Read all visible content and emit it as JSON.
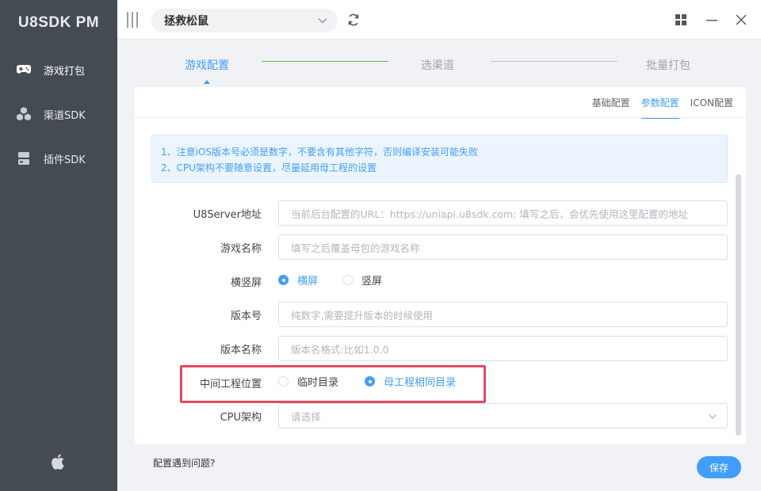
{
  "app": {
    "brand": "U8SDK PM"
  },
  "sidebar": {
    "items": [
      {
        "label": "游戏打包",
        "icon": "gamepad-icon",
        "active": true
      },
      {
        "label": "渠道SDK",
        "icon": "cubes-icon",
        "active": false
      },
      {
        "label": "插件SDK",
        "icon": "plugin-icon",
        "active": false
      }
    ],
    "footer_icon": "apple-icon"
  },
  "topbar": {
    "project": "拯救松鼠",
    "icons": [
      "menu-grip-icon",
      "chevron-down-icon",
      "refresh-icon",
      "grid-icon",
      "minimize-icon",
      "close-icon"
    ]
  },
  "steps": [
    {
      "label": "游戏配置",
      "active": true
    },
    {
      "label": "选渠道",
      "active": false
    },
    {
      "label": "批量打包",
      "active": false
    }
  ],
  "subtabs": [
    {
      "label": "基础配置",
      "active": false
    },
    {
      "label": "参数配置",
      "active": true
    },
    {
      "label": "ICON配置",
      "active": false
    }
  ],
  "notice": {
    "line1": "1、注意iOS版本号必须是数字，不要含有其他字符，否则编译安装可能失败",
    "line2": "2、CPU架构不要随意设置，尽量延用母工程的设置"
  },
  "form": {
    "server_url": {
      "label": "U8Server地址",
      "placeholder": "当前后台配置的URL：https://uniapi.u8sdk.com; 填写之后，会优先使用这里配置的地址",
      "value": ""
    },
    "game_name": {
      "label": "游戏名称",
      "placeholder": "填写之后覆盖母包的游戏名称",
      "value": ""
    },
    "orientation": {
      "label": "横竖屏",
      "options": [
        "横屏",
        "竖屏"
      ],
      "selected": "横屏"
    },
    "version_code": {
      "label": "版本号",
      "placeholder": "纯数字,需要提升版本的时候使用",
      "value": ""
    },
    "version_name": {
      "label": "版本名称",
      "placeholder": "版本名格式:比如1.0.0",
      "value": ""
    },
    "mid_project": {
      "label": "中间工程位置",
      "options": [
        "临时目录",
        "母工程相同目录"
      ],
      "selected": "母工程相同目录"
    },
    "cpu_arch": {
      "label": "CPU架构",
      "placeholder": "请选择",
      "value": ""
    }
  },
  "footer": {
    "help_link": "配置遇到问题?",
    "save_label": "保存"
  },
  "colors": {
    "primary": "#409eff",
    "sidebar": "#454b53",
    "highlight": "#e8495e",
    "step_done": "#67c23a"
  }
}
